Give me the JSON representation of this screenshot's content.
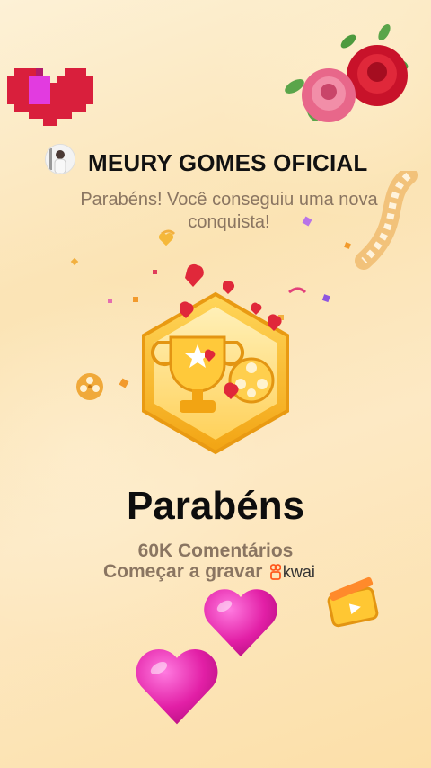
{
  "header": {
    "account_name": "MEURY GOMES OFICIAL",
    "subtitle": "Parabéns! Você conseguiu uma nova conquista!"
  },
  "achievement": {
    "title": "Parabéns",
    "stat": "60K Comentários",
    "cta": "Começar a gravar",
    "brand": "kwai"
  },
  "icons": [
    "pixel-heart-icon",
    "rose-bouquet-icon",
    "avatar",
    "trophy-icon",
    "film-reel-icon",
    "film-strip-icon",
    "clapperboard-icon",
    "heart-icon",
    "kwai-logo-icon"
  ],
  "colors": {
    "background": "#fbe3b3",
    "badge_gold": "#f5b320",
    "heart_red": "#e0283a",
    "heart_pink": "#e21fa6",
    "text_dark": "#111111",
    "text_muted": "#8a7561"
  }
}
